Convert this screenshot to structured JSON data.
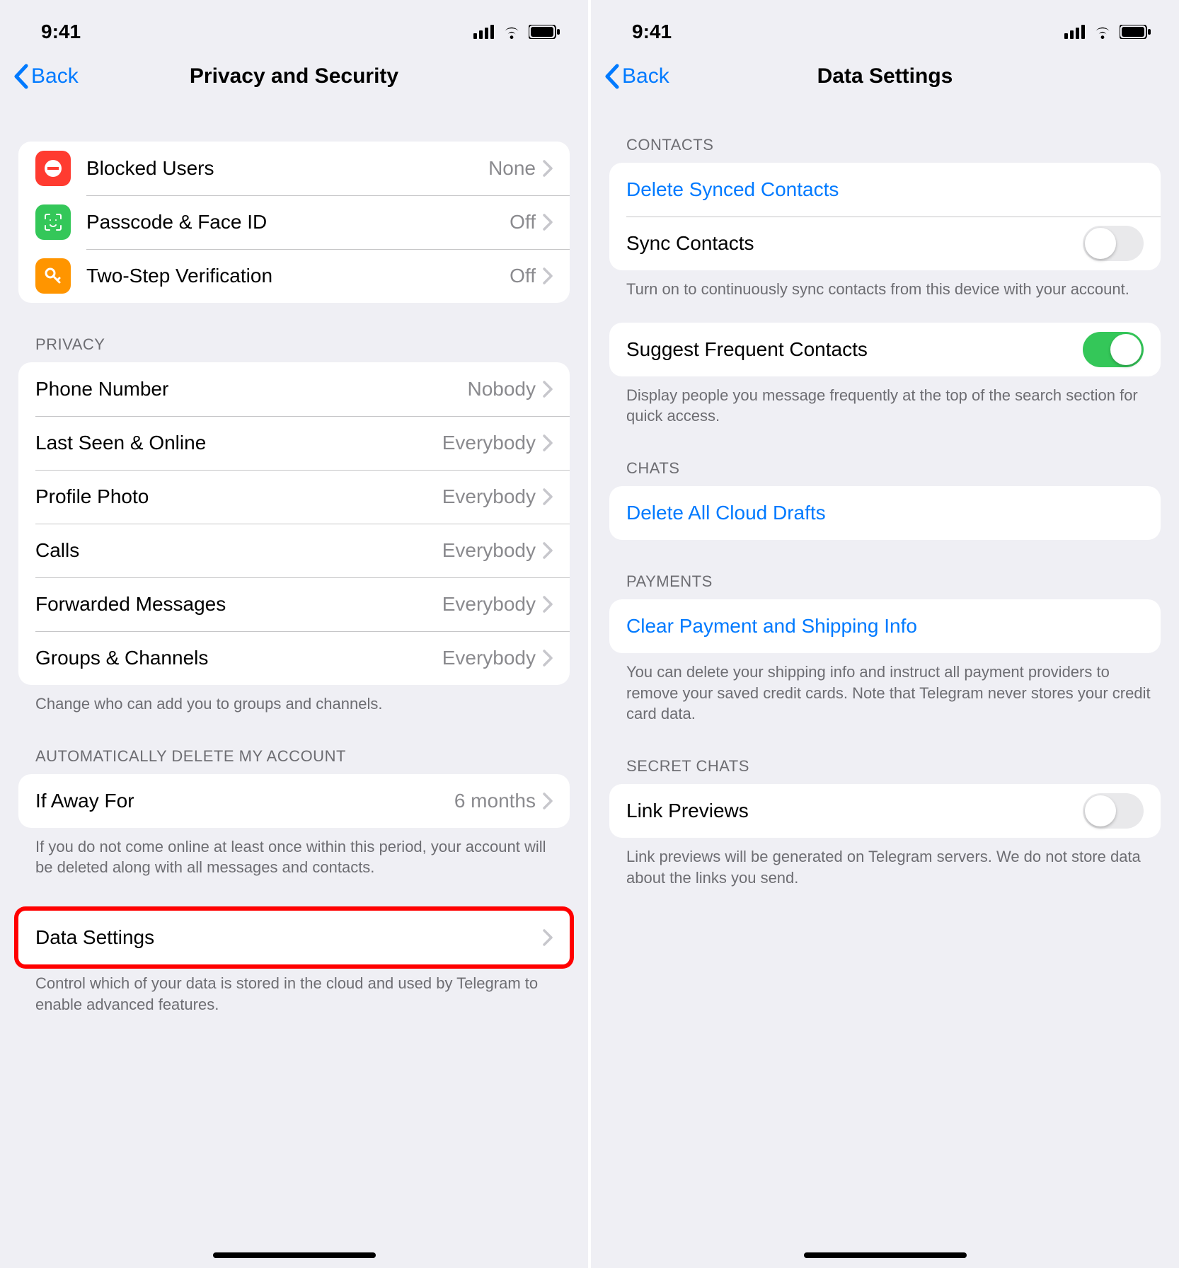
{
  "status": {
    "time": "9:41"
  },
  "screen1": {
    "nav": {
      "back": "Back",
      "title": "Privacy and Security"
    },
    "security_rows": [
      {
        "label": "Blocked Users",
        "value": "None",
        "icon": "blocked",
        "color": "#ff3b30"
      },
      {
        "label": "Passcode & Face ID",
        "value": "Off",
        "icon": "faceid",
        "color": "#34c759"
      },
      {
        "label": "Two-Step Verification",
        "value": "Off",
        "icon": "key",
        "color": "#ff9500"
      }
    ],
    "privacy_header": "PRIVACY",
    "privacy_rows": [
      {
        "label": "Phone Number",
        "value": "Nobody"
      },
      {
        "label": "Last Seen & Online",
        "value": "Everybody"
      },
      {
        "label": "Profile Photo",
        "value": "Everybody"
      },
      {
        "label": "Calls",
        "value": "Everybody"
      },
      {
        "label": "Forwarded Messages",
        "value": "Everybody"
      },
      {
        "label": "Groups & Channels",
        "value": "Everybody"
      }
    ],
    "privacy_footer": "Change who can add you to groups and channels.",
    "auto_header": "AUTOMATICALLY DELETE MY ACCOUNT",
    "auto_row": {
      "label": "If Away For",
      "value": "6 months"
    },
    "auto_footer": "If you do not come online at least once within this period, your account will be deleted along with all messages and contacts.",
    "data_row": {
      "label": "Data Settings"
    },
    "data_footer": "Control which of your data is stored in the cloud and used by Telegram to enable advanced features."
  },
  "screen2": {
    "nav": {
      "back": "Back",
      "title": "Data Settings"
    },
    "contacts_header": "CONTACTS",
    "delete_contacts": "Delete Synced Contacts",
    "sync_contacts": {
      "label": "Sync Contacts",
      "on": false
    },
    "sync_footer": "Turn on to continuously sync contacts from this device with your account.",
    "suggest": {
      "label": "Suggest Frequent Contacts",
      "on": true
    },
    "suggest_footer": "Display people you message frequently at the top of the search section for quick access.",
    "chats_header": "CHATS",
    "delete_drafts": "Delete All Cloud Drafts",
    "payments_header": "PAYMENTS",
    "clear_payment": "Clear Payment and Shipping Info",
    "payments_footer": "You can delete your shipping info and instruct all payment providers to remove your saved credit cards. Note that Telegram never stores your credit card data.",
    "secret_header": "SECRET CHATS",
    "link_previews": {
      "label": "Link Previews",
      "on": false
    },
    "secret_footer": "Link previews will be generated on Telegram servers. We do not store data about the links you send."
  }
}
